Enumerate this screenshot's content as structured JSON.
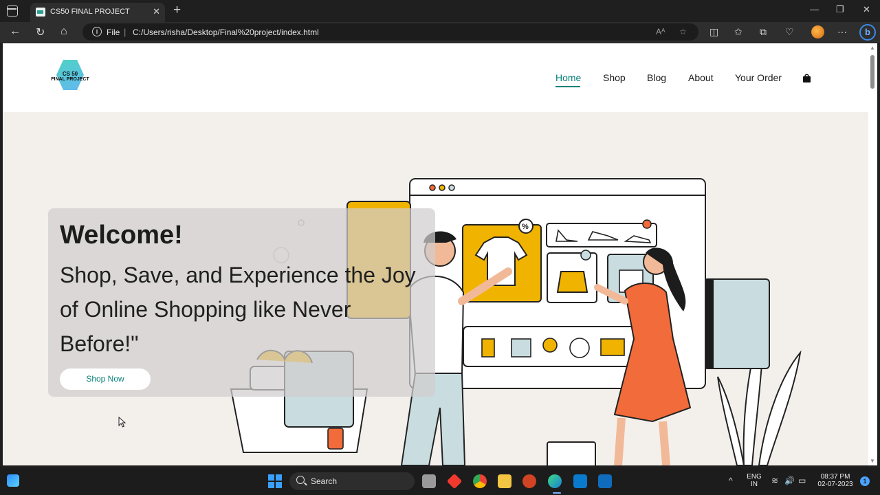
{
  "browser": {
    "tab_title": "CS50 FINAL PROJECT",
    "address_scheme_label": "File",
    "address_url": "C:/Users/risha/Desktop/Final%20project/index.html"
  },
  "site": {
    "logo_line1": "CS 50",
    "logo_line2": "FINAL PROJECT",
    "nav": {
      "home": "Home",
      "shop": "Shop",
      "blog": "Blog",
      "about": "About",
      "order": "Your Order"
    },
    "active_nav": "Home",
    "accent_color": "#088178",
    "hero": {
      "title": "Welcome!",
      "subtitle": "Shop, Save, and Experience the Joy of Online Shopping like Never Before!\"",
      "button": "Shop Now"
    }
  },
  "taskbar": {
    "search_label": "Search",
    "lang_line1": "ENG",
    "lang_line2": "IN",
    "time": "08:37 PM",
    "date": "02-07-2023"
  }
}
